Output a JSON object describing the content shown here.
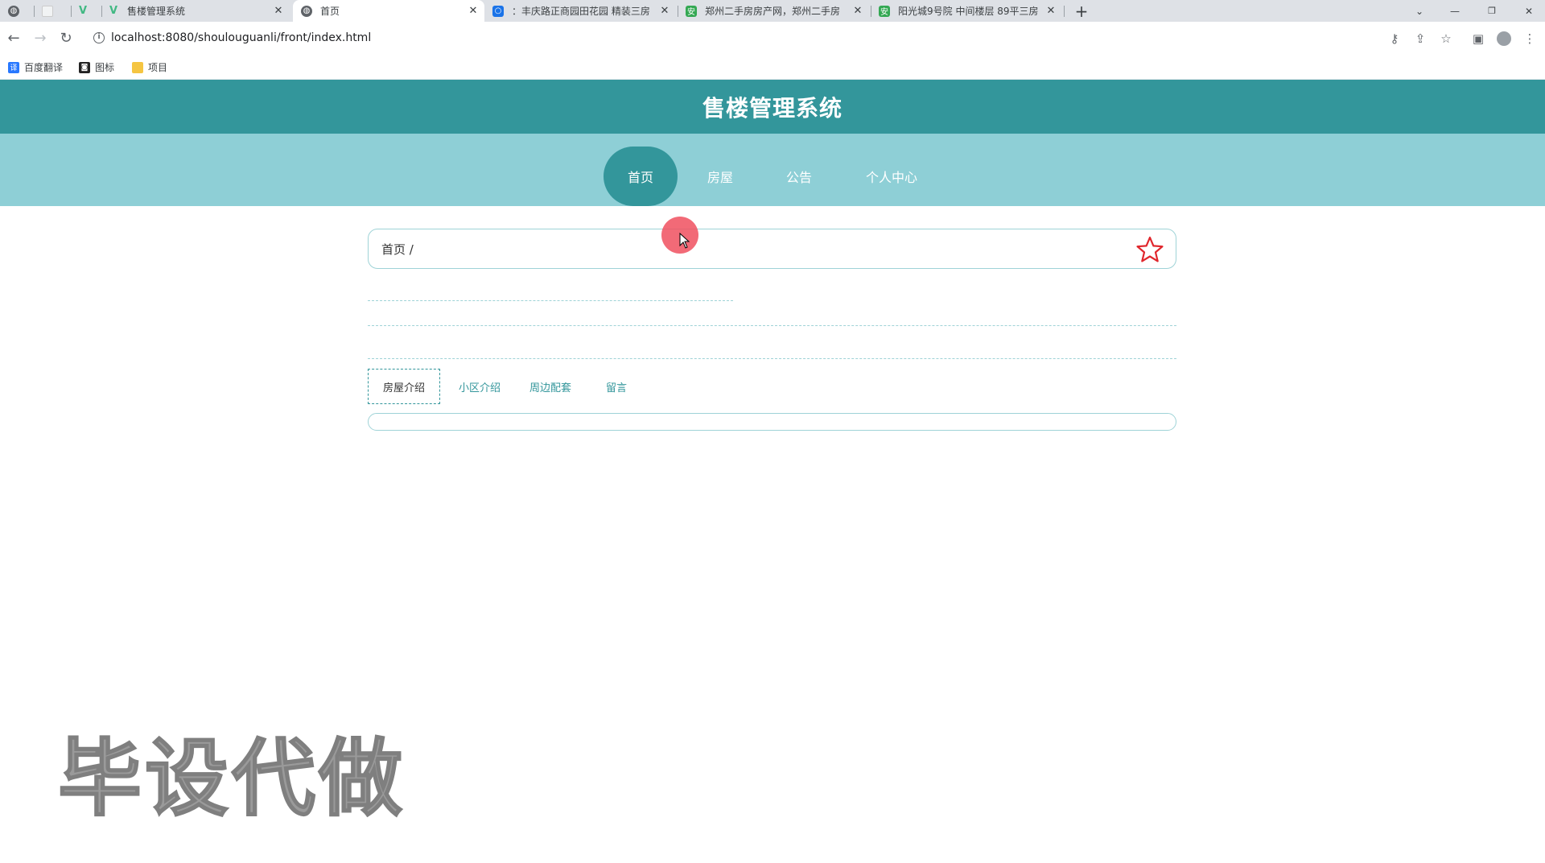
{
  "browser": {
    "tabs": [
      {
        "title": "",
        "icon": "globe-icon"
      },
      {
        "title": "",
        "icon": "blank-tab-icon"
      },
      {
        "title": "",
        "icon": "vue-icon"
      },
      {
        "title": "售楼管理系统",
        "icon": "vue-icon"
      },
      {
        "title": "首页",
        "icon": "globe-icon",
        "active": true
      },
      {
        "title": "：丰庆路正商园田花园 精装三房",
        "icon": "site-icon"
      },
      {
        "title": "郑州二手房房产网，郑州二手房",
        "icon": "anjuke-icon"
      },
      {
        "title": "阳光城9号院 中间楼层 89平三房",
        "icon": "anjuke-icon"
      }
    ],
    "new_tab_label": "+",
    "url": "localhost:8080/shoulouguanli/front/index.html",
    "bookmarks": [
      {
        "label": "百度翻译",
        "icon": "translate-icon"
      },
      {
        "label": "图标",
        "icon": "iconfont-icon"
      },
      {
        "label": "项目",
        "icon": "folder-icon"
      }
    ]
  },
  "site": {
    "title": "售楼管理系统",
    "nav": [
      "首页",
      "房屋",
      "公告",
      "个人中心"
    ],
    "active_nav": "首页",
    "breadcrumb": "首页 /",
    "detail_tabs": [
      "房屋介绍",
      "小区介绍",
      "周边配套",
      "留言"
    ],
    "active_detail_tab": "房屋介绍"
  },
  "overlay": {
    "watermark": "毕设代做"
  },
  "colors": {
    "header": "#33969b",
    "nav": "#8ecfd6",
    "accent": "#33969b",
    "star": "#e0262c"
  }
}
